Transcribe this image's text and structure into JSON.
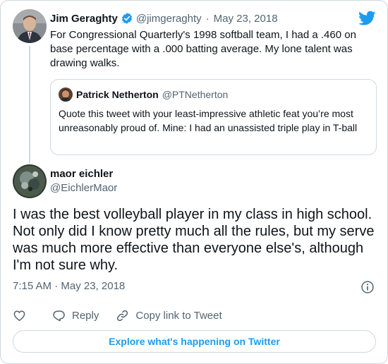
{
  "parent_tweet": {
    "author_name": "Jim Geraghty",
    "handle": "@jimgeraghty",
    "separator": "·",
    "date": "May 23, 2018",
    "text": "For Congressional Quarterly's 1998 softball team, I had a .460 on base percentage with a .000 batting average. My lone talent was drawing walks."
  },
  "quoted_tweet": {
    "author_name": "Patrick Netherton",
    "handle": "@PTNetherton",
    "text": "Quote this tweet with your least-impressive athletic feat you’re most unreasonably proud of. Mine: I had an unassisted triple play in T-ball"
  },
  "main_tweet": {
    "author_name": "maor eichler",
    "handle": "@EichlerMaor",
    "text": "I was the best volleyball player in my class in high school. Not only did I know pretty much all the rules, but my serve was much more effective than everyone else's, although I'm not sure why.",
    "timestamp": "7:15 AM · May 23, 2018"
  },
  "actions": {
    "reply_label": "Reply",
    "copy_link_label": "Copy link to Tweet"
  },
  "footer": {
    "explore_label": "Explore what's happening on Twitter"
  },
  "icons": {
    "brand": "twitter-bird-icon",
    "verified": "verified-badge-icon",
    "info": "info-icon",
    "like": "heart-icon",
    "reply": "reply-bubble-icon",
    "copy": "link-icon"
  },
  "colors": {
    "brand_blue": "#1d9bf0",
    "text_primary": "#0f1419",
    "text_secondary": "#536471",
    "border": "#cfd9de"
  }
}
